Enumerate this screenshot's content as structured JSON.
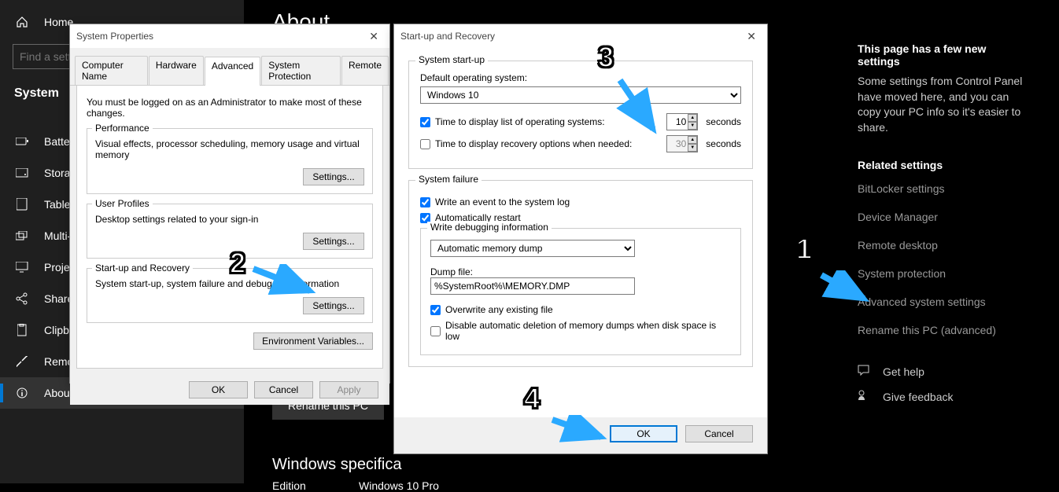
{
  "sidebar": {
    "home": "Home",
    "search_placeholder": "Find a setting",
    "items": [
      {
        "label": "System"
      },
      {
        "label": "Battery"
      },
      {
        "label": "Storage"
      },
      {
        "label": "Tablet"
      },
      {
        "label": "Multi-"
      },
      {
        "label": "Project"
      },
      {
        "label": "Shared"
      },
      {
        "label": "Clipbo"
      },
      {
        "label": "Remote Desktop"
      },
      {
        "label": "About"
      }
    ]
  },
  "main": {
    "title": "About",
    "rename": "Rename this PC",
    "spec_head": "Windows specifica",
    "edition_label": "Edition",
    "edition_value": "Windows 10 Pro"
  },
  "right": {
    "head": "This page has a few new settings",
    "text": "Some settings from Control Panel have moved here, and you can copy your PC info so it's easier to share.",
    "related_head": "Related settings",
    "links": [
      "BitLocker settings",
      "Device Manager",
      "Remote desktop",
      "System protection",
      "Advanced system settings",
      "Rename this PC (advanced)"
    ],
    "get_help": "Get help",
    "give_feedback": "Give feedback"
  },
  "sysprop": {
    "title": "System Properties",
    "tabs": [
      "Computer Name",
      "Hardware",
      "Advanced",
      "System Protection",
      "Remote"
    ],
    "hint": "You must be logged on as an Administrator to make most of these changes.",
    "perf_title": "Performance",
    "perf_desc": "Visual effects, processor scheduling, memory usage and virtual memory",
    "settings_btn": "Settings...",
    "profiles_title": "User Profiles",
    "profiles_desc": "Desktop settings related to your sign-in",
    "startup_title": "Start-up and Recovery",
    "startup_desc": "System start-up, system failure and debugging information",
    "envvars": "Environment Variables...",
    "ok": "OK",
    "cancel": "Cancel",
    "apply": "Apply"
  },
  "startup": {
    "title": "Start-up and Recovery",
    "sys_startup": "System start-up",
    "default_os_label": "Default operating system:",
    "default_os": "Windows 10",
    "time_list_label": "Time to display list of operating systems:",
    "time_list_value": "10",
    "time_recovery_label": "Time to display recovery options when needed:",
    "time_recovery_value": "30",
    "seconds": "seconds",
    "sys_failure": "System failure",
    "write_event": "Write an event to the system log",
    "auto_restart": "Automatically restart",
    "write_debug_head": "Write debugging information",
    "debug_select": "Automatic memory dump",
    "dump_label": "Dump file:",
    "dump_value": "%SystemRoot%\\MEMORY.DMP",
    "overwrite": "Overwrite any existing file",
    "disable_auto": "Disable automatic deletion of memory dumps when disk space is low",
    "ok": "OK",
    "cancel": "Cancel"
  },
  "anno": {
    "n1": "1",
    "n2": "2",
    "n3": "3",
    "n4": "4"
  }
}
